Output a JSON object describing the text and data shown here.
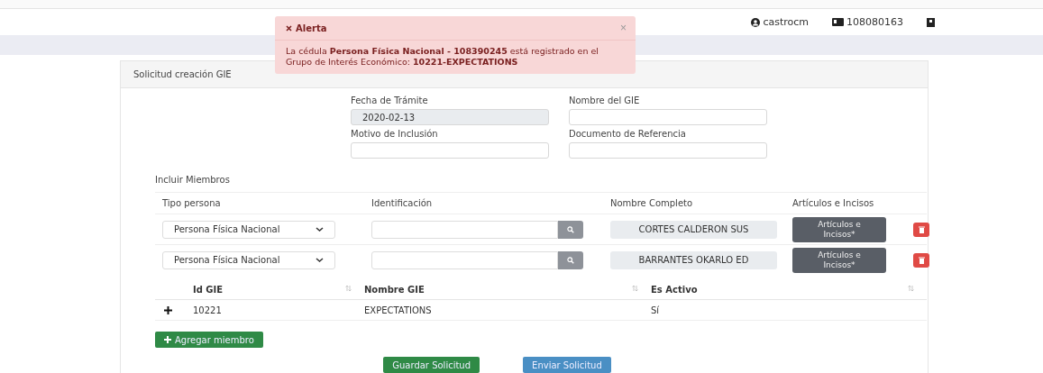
{
  "header": {
    "user": "castrocm",
    "id_number": "108080163"
  },
  "alert": {
    "title": "Alerta",
    "message": "La cédula **Persona Física Nacional - 108390245** está registrado en el Grupo de Interés Económico: **10221-EXPECTATIONS**",
    "close": "×"
  },
  "card": {
    "title": "Solicitud creación GIE"
  },
  "form": [
    {
      "label": "Fecha de Trámite",
      "value": "2020-02-13",
      "disabled": true
    },
    {
      "label": "Nombre del GIE",
      "disabled": false
    },
    {
      "label": "Motivo de Inclusión",
      "disabled": false
    },
    {
      "label": "Documento de Referencia",
      "disabled": false
    }
  ],
  "members": {
    "title": "Incluir Miembros",
    "columns": [
      "Tipo persona",
      "Identificación",
      "Nombre Completo",
      "Artículos e Incisos"
    ],
    "rows": [
      {
        "tipo": "Persona Física Nacional",
        "nombre": "CORTES CALDERON SUS",
        "articulos": "Artículos e Incisos*"
      },
      {
        "tipo": "Persona Física Nacional",
        "nombre": "BARRANTES OKARLO ED",
        "articulos": "Artículos e Incisos*"
      }
    ]
  },
  "gie_table": {
    "columns": [
      "Id GIE",
      "Nombre GIE",
      "Es Activo"
    ],
    "rows": [
      {
        "cells": [
          "10221",
          "EXPECTATIONS",
          "Sí"
        ]
      }
    ]
  },
  "buttons": {
    "add": "Agregar miembro",
    "save": "Guardar Solicitud",
    "send": "Enviar Solicitud"
  }
}
